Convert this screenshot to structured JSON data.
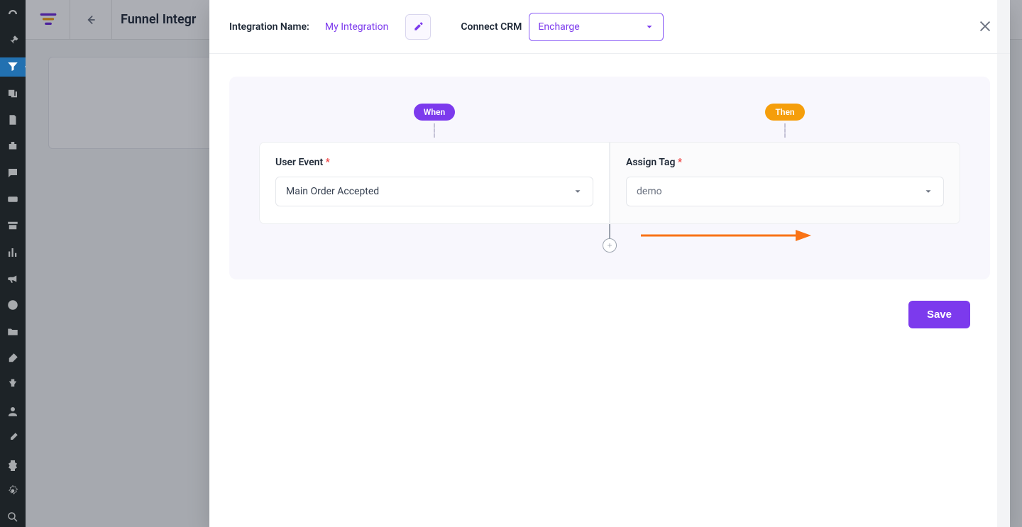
{
  "header": {
    "page_title": "Funnel Integr",
    "integration_name_label": "Integration Name:",
    "integration_name_value": "My Integration",
    "connect_crm_label": "Connect CRM",
    "crm_selected": "Encharge"
  },
  "flow": {
    "when_label": "When",
    "then_label": "Then",
    "user_event_label": "User Event",
    "user_event_value": "Main Order Accepted",
    "assign_tag_label": "Assign Tag",
    "assign_tag_value": "demo"
  },
  "actions": {
    "save": "Save"
  }
}
